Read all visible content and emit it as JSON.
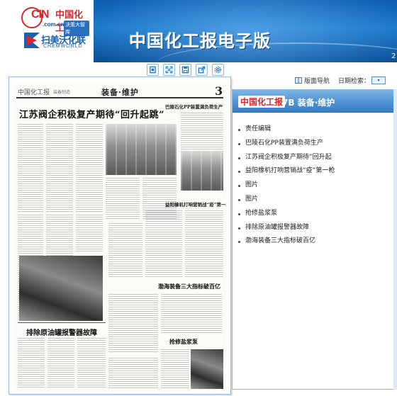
{
  "header": {
    "logo_cin_text": "CIN",
    "logo_cin_paper": "中国化工报",
    "logo_cin_domain": ".com.cn",
    "logo_cin_tag": "决策大智库",
    "logo_cw_name": "扫美沃化联",
    "logo_cw_en": "CHEMWORLD",
    "site_title": "中国化工报电子版",
    "date_fragment": "2"
  },
  "toolbar": {
    "buttons": [
      {
        "name": "page-view",
        "icon": "page-icon"
      },
      {
        "name": "fullscreen",
        "icon": "expand-icon"
      },
      {
        "name": "save",
        "icon": "save-icon"
      },
      {
        "name": "share",
        "icon": "share-icon"
      },
      {
        "name": "settings",
        "icon": "gear-icon"
      }
    ]
  },
  "newspaper": {
    "masthead_logo": "中国化工报",
    "masthead_sub": "装备制造",
    "section_title": "装备·维护",
    "page_number": "3",
    "headline_main": "江苏阀企积极复产期待“回升起跳”",
    "headline_bottom": "排除原油罐报警器故障",
    "col_head_1": "巴陵石化PP装置满负荷生产",
    "col_head_2": "益阳橡机打响营销战“疫”第一枪",
    "col_head_3": "渤海装备三大指标破百亿",
    "col_head_4": "抢修盐浆泵"
  },
  "nav": {
    "layout_nav_label": "版面导航",
    "date_search_label": "日期检索：",
    "date_select_value": "▾"
  },
  "panel": {
    "logo": "中国化工报",
    "page_code": "7B",
    "section": "装备·维护",
    "articles": [
      "责任编辑",
      "巴陵石化PP装置满负荷生产",
      "江苏阀企积极复产期待“回升起",
      "益阳橡机打响营销战“疫”第一枪",
      "图片",
      "图片",
      "抢修盐浆泵",
      "排除原油罐报警器故障",
      "渤海装备三大指标破百亿"
    ]
  },
  "colors": {
    "header_blue": "#0c5dae",
    "brand_red": "#d8262b",
    "panel_blue": "#4f91d2"
  }
}
